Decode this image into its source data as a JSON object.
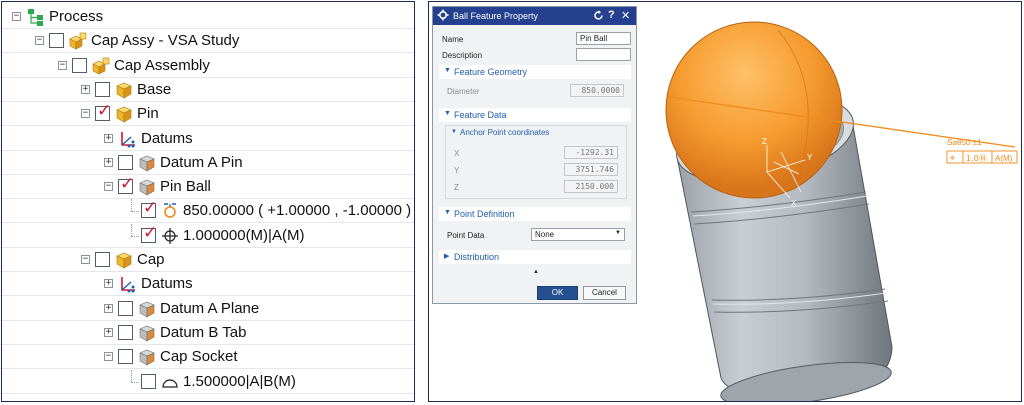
{
  "tree": {
    "nodes": [
      {
        "label": "Process",
        "icon": "process-icon",
        "checked": null
      },
      {
        "label": "Cap Assy - VSA Study",
        "icon": "assembly-icon",
        "checked": false
      },
      {
        "label": "Cap Assembly",
        "icon": "assembly-icon",
        "checked": false
      },
      {
        "label": "Base",
        "icon": "part-icon",
        "checked": false
      },
      {
        "label": "Pin",
        "icon": "part-icon",
        "checked": true
      },
      {
        "label": "Datums",
        "icon": "datums-icon",
        "checked": null
      },
      {
        "label": "Datum A Pin",
        "icon": "feature-icon",
        "checked": false
      },
      {
        "label": "Pin Ball",
        "icon": "feature-icon",
        "checked": true
      },
      {
        "label": "850.00000 ( +1.00000 , -1.00000 )",
        "icon": "size-tolerance-icon",
        "checked": true
      },
      {
        "label": "1.000000(M)|A(M)",
        "icon": "position-tolerance-icon",
        "checked": true
      },
      {
        "label": "Cap",
        "icon": "part-icon",
        "checked": false
      },
      {
        "label": "Datums",
        "icon": "datums-icon",
        "checked": null
      },
      {
        "label": "Datum A Plane",
        "icon": "feature-icon",
        "checked": false
      },
      {
        "label": "Datum B Tab",
        "icon": "feature-icon",
        "checked": false
      },
      {
        "label": "Cap Socket",
        "icon": "feature-icon",
        "checked": false
      },
      {
        "label": "1.500000|A|B(M)",
        "icon": "profile-tolerance-icon",
        "checked": false
      }
    ]
  },
  "dialog": {
    "title": "Ball Feature Property",
    "title_icons": [
      "gear-icon",
      "reset-icon",
      "help-icon",
      "close-icon"
    ],
    "help_glyph": "?",
    "close_glyph": "✕",
    "name_label": "Name",
    "name_value": "Pin Ball",
    "description_label": "Description",
    "description_value": "",
    "sections": {
      "feature_geometry": "Feature Geometry",
      "diameter_label": "Diameter",
      "diameter_value": "850.0000",
      "feature_data": "Feature Data",
      "anchor_point": "Anchor Point coordinates",
      "x_label": "X",
      "x_value": "-1292.31",
      "y_label": "Y",
      "y_value": "3751.746",
      "z_label": "Z",
      "z_value": "2150.000",
      "point_definition": "Point Definition",
      "point_data_label": "Point Data",
      "point_data_value": "None",
      "distribution": "Distribution"
    },
    "ok_label": "OK",
    "cancel_label": "Cancel"
  },
  "viewport": {
    "annotation_line1": "S⌀850 ±1",
    "annotation_frame": [
      "⌖",
      "1.0Ⓜ",
      "A(M)"
    ],
    "axis_labels": [
      "Z",
      "Y",
      "X"
    ],
    "ball_color": "#f59a2e",
    "pin_color": "#b7bdc2",
    "annotation_color": "#f08a1c"
  },
  "colors": {
    "title_bar": "#24408e",
    "section_text": "#1f5fb0",
    "check_red": "#d6162e"
  }
}
